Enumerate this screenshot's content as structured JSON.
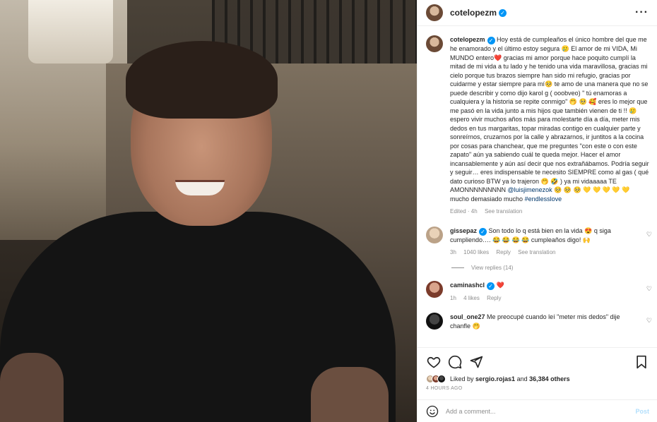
{
  "post": {
    "username": "cotelopezm",
    "caption_parts": [
      "Hoy está de cumpleaños el único hombre del que me he enamorado y el último estoy segura 🥲 El amor de mi VIDA, Mi MUNDO entero❤️  gracias mi amor porque hace poquito cumplí la mitad de mi vida a tu lado y he tenido una vida maravillosa, gracias mi cielo porque tus brazos siempre han sido mi refugio, gracias por cuidarme y estar siempre para mí🥺 te amo de una manera que no se puede describir y como dijo karol g ( ooobveo) \" tú enamoras a cualquiera y la historia se repite conmigo\" 🤭 🥺 🥰  eres lo mejor que me pasó en la vida junto a mis hijos que también vienen de ti !! 🥲 espero vivir muchos años más para molestarte día a día, meter mis dedos en tus margaritas, topar miradas contigo en cualquier parte y sonreírnos, cruzarnos por la calle y abrazarnos, ir juntitos a la cocina por cosas para chanchear, que me preguntes \"con este o con este zapato\" aún ya sabiendo cuál te queda mejor. Hacer el amor incansablemente y aún así decir que nos extrañábamos. Podría seguir y seguir… eres indispensable te necesito SIEMPRE como al gas ( qué dato curioso BTW ya lo trajeron 🤭 🤣 ) ya mi vidaaaaa TE AMONNNNNNNNN ",
      "@luisjimenezok",
      " 🥺 🥺 🥺 💛 💛 💛 💛 💛  mucho demasiado mucho ",
      "#endlesslove"
    ],
    "edited": "Edited · 4h",
    "see_translation": "See translation"
  },
  "comments": [
    {
      "username": "gissepaz",
      "text": "Son todo lo q está bien en la vida 😍 q siga cumpliendo…. 😂 😂 😂 😂  cumpleaños digo! 🙌",
      "time": "3h",
      "likes": "1040 likes",
      "reply": "Reply",
      "translate": "See translation",
      "view_replies": "View replies (14)"
    },
    {
      "username": "caminashcl",
      "text": "❤️",
      "time": "1h",
      "likes": "4 likes",
      "reply": "Reply"
    },
    {
      "username": "soul_one27",
      "text": "Me preocupé cuando leí \"meter mis dedos\" dije chanfle 🤭"
    }
  ],
  "likes": {
    "liked_by_prefix": "Liked by ",
    "liked_by_user": "sergio.rojas1",
    "and": " and ",
    "others": "36,384 others"
  },
  "time_ago": "4 HOURS AGO",
  "add_comment": {
    "placeholder": "Add a comment...",
    "post_label": "Post"
  },
  "colors": {
    "verified": "#0095f6",
    "link": "#00376b",
    "muted": "#8e8e8e",
    "post_disabled": "#b2dffc"
  }
}
